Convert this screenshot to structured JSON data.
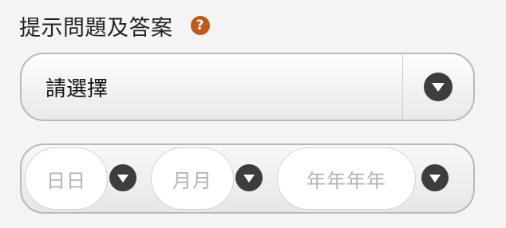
{
  "security": {
    "title": "提示問題及答案",
    "help_glyph": "?",
    "help_color": "#c0591a"
  },
  "question_select": {
    "selected": "請選擇",
    "arrow_icon": "chevron-down-icon"
  },
  "birth_date": {
    "day_placeholder": "日日",
    "month_placeholder": "月月",
    "year_placeholder": "年年年年",
    "arrow_icon": "chevron-down-icon"
  }
}
